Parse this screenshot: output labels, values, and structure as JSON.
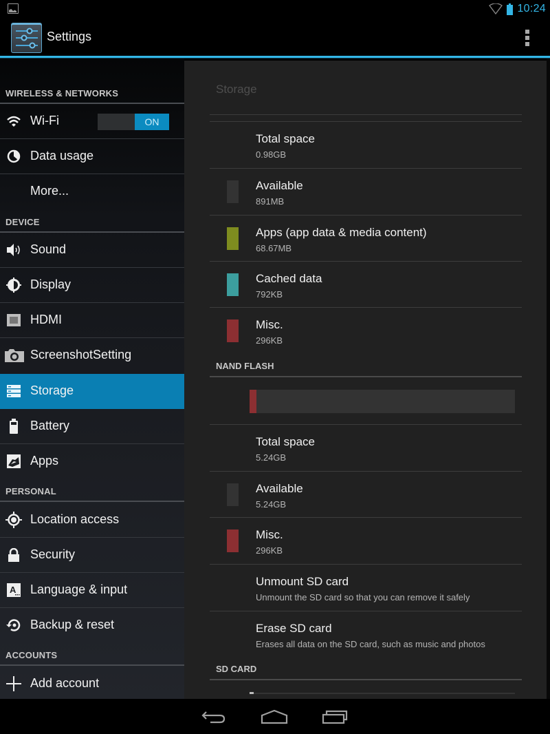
{
  "status_bar": {
    "time": "10:24",
    "icons": [
      "notification-image-icon",
      "wifi-icon",
      "battery-icon"
    ]
  },
  "action_bar": {
    "title": "Settings",
    "icon": "settings-sliders-icon",
    "overflow": "overflow-menu-icon"
  },
  "sidebar": {
    "sections": [
      {
        "header": "WIRELESS & NETWORKS",
        "items": [
          {
            "label": "Wi-Fi",
            "icon": "wifi-icon",
            "toggle": "ON"
          },
          {
            "label": "Data usage",
            "icon": "data-usage-icon"
          },
          {
            "label": "More...",
            "icon": ""
          }
        ]
      },
      {
        "header": "DEVICE",
        "items": [
          {
            "label": "Sound",
            "icon": "speaker-icon"
          },
          {
            "label": "Display",
            "icon": "brightness-icon"
          },
          {
            "label": "HDMI",
            "icon": "hdmi-icon"
          },
          {
            "label": "ScreenshotSetting",
            "icon": "camera-icon"
          },
          {
            "label": "Storage",
            "icon": "storage-icon",
            "active": true
          },
          {
            "label": "Battery",
            "icon": "battery-icon"
          },
          {
            "label": "Apps",
            "icon": "apps-icon"
          }
        ]
      },
      {
        "header": "PERSONAL",
        "items": [
          {
            "label": "Location access",
            "icon": "location-icon"
          },
          {
            "label": "Security",
            "icon": "lock-icon"
          },
          {
            "label": "Language & input",
            "icon": "language-icon"
          },
          {
            "label": "Backup & reset",
            "icon": "backup-icon"
          }
        ]
      },
      {
        "header": "ACCOUNTS",
        "items": [
          {
            "label": "Add account",
            "icon": "plus-icon"
          }
        ]
      }
    ]
  },
  "content": {
    "title": "Storage",
    "internal": {
      "rows": [
        {
          "title": "Total space",
          "value": "0.98GB",
          "color": null
        },
        {
          "title": "Available",
          "value": "891MB",
          "color": "#333333"
        },
        {
          "title": "Apps (app data & media content)",
          "value": "68.67MB",
          "color": "#7e8c1f"
        },
        {
          "title": "Cached data",
          "value": "792KB",
          "color": "#3c9e9e"
        },
        {
          "title": "Misc.",
          "value": "296KB",
          "color": "#8c2f32"
        }
      ]
    },
    "nand_flash": {
      "header": "NAND FLASH",
      "usage_bar": {
        "segments": [
          {
            "name": "Misc.",
            "fraction": 0.026,
            "color": "#8c2f32"
          }
        ],
        "background": "#333333"
      },
      "rows": [
        {
          "title": "Total space",
          "value": "5.24GB",
          "color": null
        },
        {
          "title": "Available",
          "value": "5.24GB",
          "color": "#333333"
        },
        {
          "title": "Misc.",
          "value": "296KB",
          "color": "#8c2f32"
        }
      ],
      "actions": [
        {
          "title": "Unmount SD card",
          "subtitle": "Unmount the SD card so that you can remove it safely"
        },
        {
          "title": "Erase SD card",
          "subtitle": "Erases all data on the SD card, such as music and photos"
        }
      ]
    },
    "sd_card": {
      "header": "SD CARD"
    }
  },
  "nav_bar": {
    "buttons": [
      "back-icon",
      "home-icon",
      "recent-apps-icon"
    ]
  },
  "colors": {
    "accent": "#33b5e5",
    "active_item": "#0a7fb3",
    "toggle_on": "#0b8bc0"
  }
}
